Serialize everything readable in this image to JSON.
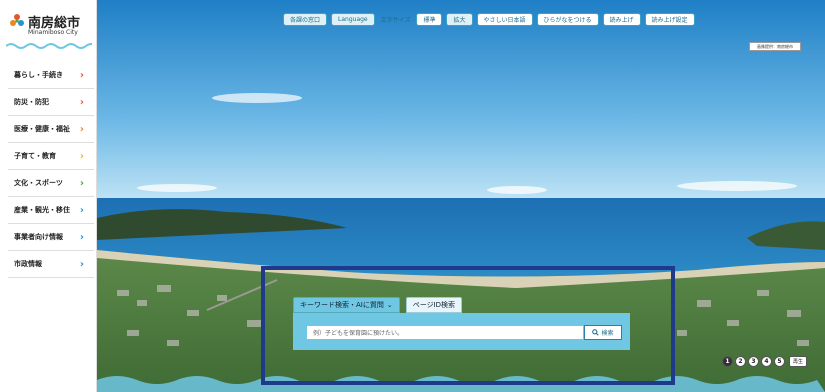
{
  "logo": {
    "name_ja": "南房総市",
    "name_en": "Minamiboso City"
  },
  "sidebar": {
    "items": [
      {
        "label": "暮らし・手続き",
        "chevron_color": "#e4572e"
      },
      {
        "label": "防災・防犯",
        "chevron_color": "#e4572e"
      },
      {
        "label": "医療・健康・福祉",
        "chevron_color": "#e8891c"
      },
      {
        "label": "子育て・教育",
        "chevron_color": "#e8b41c"
      },
      {
        "label": "文化・スポーツ",
        "chevron_color": "#4aa84a"
      },
      {
        "label": "産業・観光・移住",
        "chevron_color": "#2a8fd6"
      },
      {
        "label": "事業者向け情報",
        "chevron_color": "#2a8fd6"
      },
      {
        "label": "市政情報",
        "chevron_color": "#2a8fd6"
      }
    ]
  },
  "topbar": {
    "window_label": "各課の窓口",
    "language_label": "Language",
    "font_size_label": "文字サイズ",
    "font_standard": "標準",
    "font_large": "拡大",
    "easy_japanese": "やさしい日本語",
    "furigana": "ひらがなをつける",
    "read_aloud": "読み上げ",
    "read_settings": "読み上げ設定"
  },
  "credit": "画像提供：南房総市",
  "search": {
    "tab_keyword": "キーワード検索・AIに質問",
    "tab_page_id": "ページID検索",
    "placeholder": "例）子どもを保育園に預けたい。",
    "button": "検索"
  },
  "slider": {
    "pages": [
      "1",
      "2",
      "3",
      "4",
      "5"
    ],
    "active": 1,
    "play_label": "再生"
  },
  "colors": {
    "accent": "#3aa3c4",
    "search_bg": "#6fc7e3",
    "highlight_frame": "#1f3a8a"
  }
}
